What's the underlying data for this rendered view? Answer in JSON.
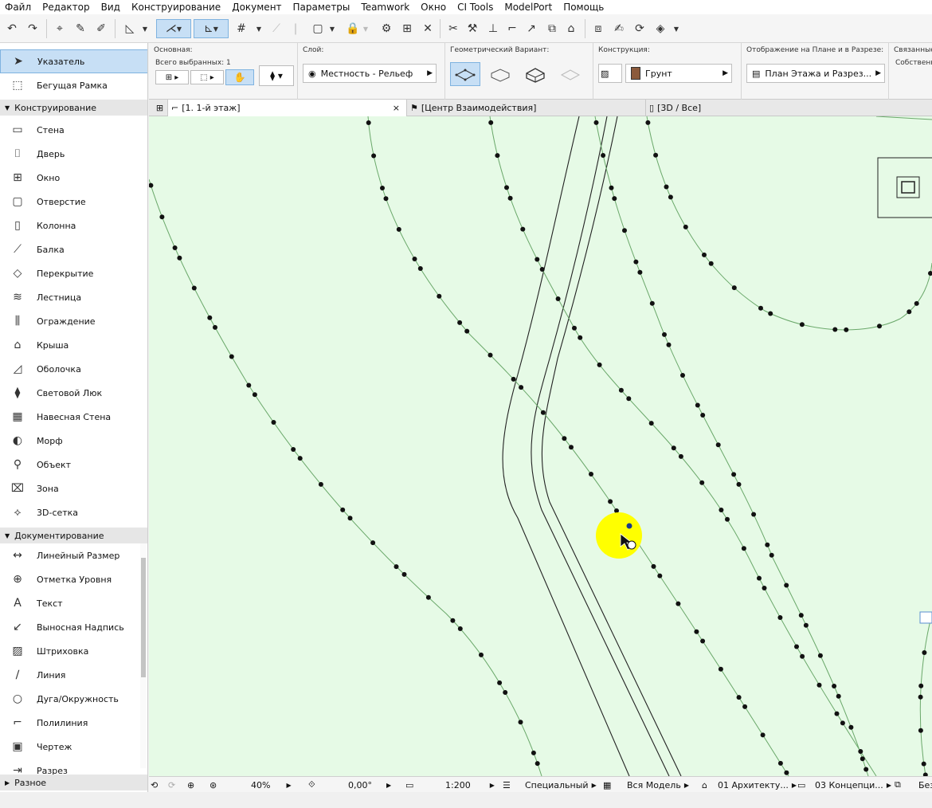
{
  "menu": [
    "Файл",
    "Редактор",
    "Вид",
    "Конструирование",
    "Документ",
    "Параметры",
    "Teamwork",
    "Окно",
    "CI Tools",
    "ModelPort",
    "Помощь"
  ],
  "infobox": {
    "main_title": "Основная:",
    "main_sub": "Всего выбранных: 1",
    "layer_title": "Слой:",
    "layer_value": "Местность - Рельеф",
    "geo_title": "Геометрический Вариант:",
    "construction_title": "Конструкция:",
    "construction_value": "Грунт",
    "display_title": "Отображение на Плане и в Разрезе:",
    "display_value": "План Этажа и Разрез...",
    "linked_title": "Связанные З",
    "linked_sub": "Собственны"
  },
  "palette": {
    "top_items": [
      {
        "label": "Указатель",
        "icon": "arrow-pointer-icon"
      },
      {
        "label": "Бегущая Рамка",
        "icon": "marquee-icon"
      }
    ],
    "section_design": "Конструирование",
    "design_items": [
      {
        "label": "Стена",
        "icon": "wall-icon"
      },
      {
        "label": "Дверь",
        "icon": "door-icon"
      },
      {
        "label": "Окно",
        "icon": "window-icon"
      },
      {
        "label": "Отверстие",
        "icon": "opening-icon"
      },
      {
        "label": "Колонна",
        "icon": "column-icon"
      },
      {
        "label": "Балка",
        "icon": "beam-icon"
      },
      {
        "label": "Перекрытие",
        "icon": "slab-icon"
      },
      {
        "label": "Лестница",
        "icon": "stair-icon"
      },
      {
        "label": "Ограждение",
        "icon": "railing-icon"
      },
      {
        "label": "Крыша",
        "icon": "roof-icon"
      },
      {
        "label": "Оболочка",
        "icon": "shell-icon"
      },
      {
        "label": "Световой Люк",
        "icon": "skylight-icon"
      },
      {
        "label": "Навесная Стена",
        "icon": "curtain-wall-icon"
      },
      {
        "label": "Морф",
        "icon": "morph-icon"
      },
      {
        "label": "Объект",
        "icon": "object-icon"
      },
      {
        "label": "Зона",
        "icon": "zone-icon"
      },
      {
        "label": "3D-сетка",
        "icon": "mesh-icon"
      }
    ],
    "section_doc": "Документирование",
    "doc_items": [
      {
        "label": "Линейный Размер",
        "icon": "dimension-icon"
      },
      {
        "label": "Отметка Уровня",
        "icon": "level-icon"
      },
      {
        "label": "Текст",
        "icon": "text-icon"
      },
      {
        "label": "Выносная Надпись",
        "icon": "label-icon"
      },
      {
        "label": "Штриховка",
        "icon": "fill-icon"
      },
      {
        "label": "Линия",
        "icon": "line-icon"
      },
      {
        "label": "Дуга/Окружность",
        "icon": "arc-icon"
      },
      {
        "label": "Полилиния",
        "icon": "polyline-icon"
      },
      {
        "label": "Чертеж",
        "icon": "drawing-icon"
      },
      {
        "label": "Разрез",
        "icon": "section-icon"
      }
    ],
    "section_misc": "Разное"
  },
  "tabs": [
    {
      "label": "[1. 1-й этаж]",
      "close": "×"
    },
    {
      "label": "[Центр Взаимодействия]"
    },
    {
      "label": "[3D / Все]"
    }
  ],
  "status": {
    "zoom": "40%",
    "angle": "0,00°",
    "scale": "1:200",
    "pen_set": "Специальный",
    "model": "Вся Модель",
    "layer_combo": "01 Архитекту...",
    "view": "03 Концепци...",
    "last": "Без"
  },
  "colors": {
    "canvas": "#e6fae6",
    "selection": "#c7dff5",
    "highlight": "#ffff00"
  }
}
